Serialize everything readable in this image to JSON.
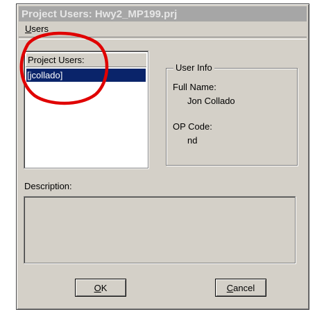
{
  "window": {
    "title": "Project Users: Hwy2_MP199.prj"
  },
  "menu": {
    "items": [
      {
        "mnemonic": "U",
        "rest": "sers"
      }
    ]
  },
  "users_list": {
    "header": "Project Users:",
    "items": [
      {
        "label": "[jcollado]",
        "selected": true
      }
    ]
  },
  "user_info": {
    "legend": "User Info",
    "full_name_label": "Full Name:",
    "full_name_value": "Jon Collado",
    "op_code_label": "OP Code:",
    "op_code_value": "nd"
  },
  "description": {
    "label": "Description:",
    "value": ""
  },
  "buttons": {
    "ok": {
      "mnemonic": "O",
      "rest": "K"
    },
    "cancel": {
      "mnemonic": "C",
      "rest": "ancel"
    }
  },
  "colors": {
    "dialog_bg": "#d4d0c8",
    "selection": "#0a246a",
    "annotation": "#e00000",
    "title_bar": "#a6a6a6"
  }
}
